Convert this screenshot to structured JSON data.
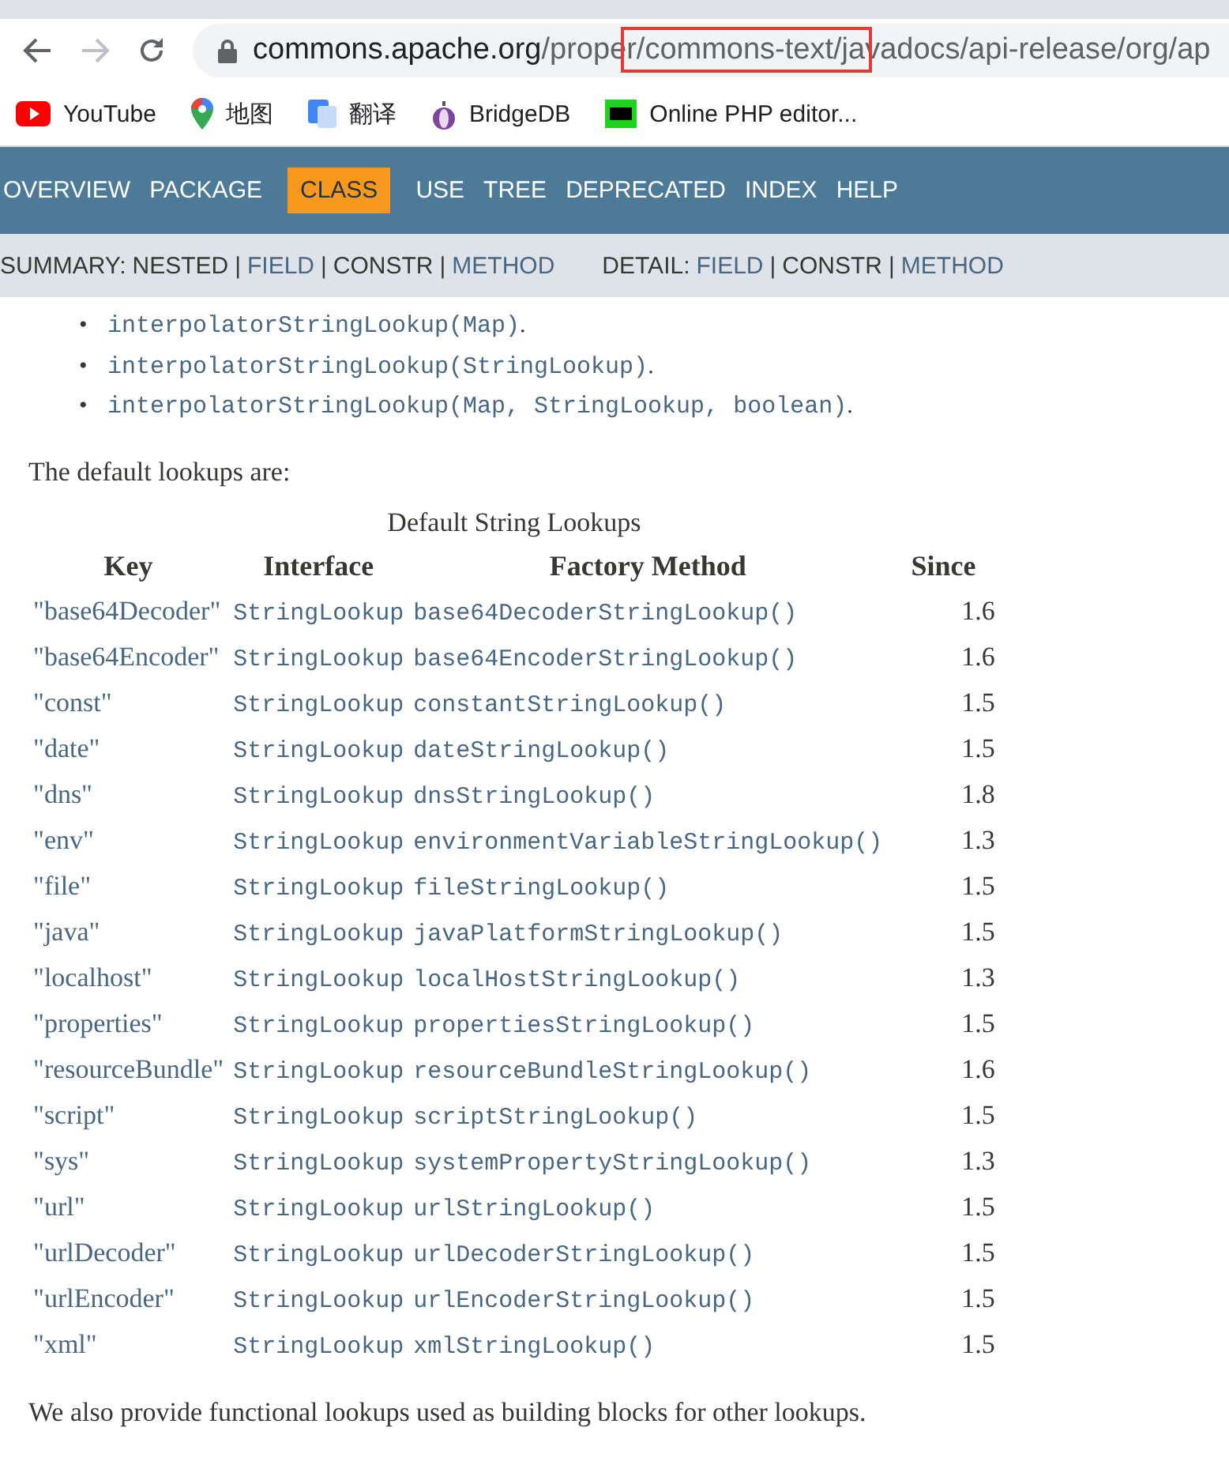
{
  "browser": {
    "url": {
      "host": "commons.apache.org",
      "path_before": "/prope",
      "highlighted": "r/commons-text/ja",
      "path_after": "vadocs/api-release/org/ap"
    },
    "bookmarks": [
      {
        "kind": "youtube",
        "label": "YouTube"
      },
      {
        "kind": "maps",
        "label": "地图"
      },
      {
        "kind": "translate",
        "label": "翻译"
      },
      {
        "kind": "onion",
        "label": "BridgeDB"
      },
      {
        "kind": "php",
        "label": "Online PHP editor..."
      }
    ]
  },
  "nav": [
    {
      "label": "OVERVIEW",
      "selected": false
    },
    {
      "label": "PACKAGE",
      "selected": false
    },
    {
      "label": "CLASS",
      "selected": true
    },
    {
      "label": "USE",
      "selected": false
    },
    {
      "label": "TREE",
      "selected": false
    },
    {
      "label": "DEPRECATED",
      "selected": false
    },
    {
      "label": "INDEX",
      "selected": false
    },
    {
      "label": "HELP",
      "selected": false
    }
  ],
  "subnav": [
    {
      "title": "SUMMARY:",
      "items": [
        {
          "label": "NESTED",
          "kind": "plain"
        },
        {
          "label": "FIELD",
          "kind": "link"
        },
        {
          "label": "CONSTR",
          "kind": "plain"
        },
        {
          "label": "METHOD",
          "kind": "link"
        }
      ]
    },
    {
      "title": "DETAIL:",
      "items": [
        {
          "label": "FIELD",
          "kind": "link"
        },
        {
          "label": "CONSTR",
          "kind": "plain"
        },
        {
          "label": "METHOD",
          "kind": "link"
        }
      ]
    }
  ],
  "separator": "|",
  "list": [
    {
      "bullet": "•",
      "link": "interpolatorStringLookup(Map)",
      "after": "."
    },
    {
      "bullet": "•",
      "link": "interpolatorStringLookup(StringLookup)",
      "after": "."
    },
    {
      "bullet": "•",
      "link": "interpolatorStringLookup(Map, StringLookup, boolean)",
      "after": "."
    }
  ],
  "intro": "The default lookups are:",
  "table": {
    "caption": "Default String Lookups",
    "columns": [
      "Key",
      "Interface",
      "Factory Method",
      "Since"
    ],
    "rows": [
      [
        "\"base64Decoder\"",
        "StringLookup",
        "base64DecoderStringLookup()",
        "1.6"
      ],
      [
        "\"base64Encoder\"",
        "StringLookup",
        "base64EncoderStringLookup()",
        "1.6"
      ],
      [
        "\"const\"",
        "StringLookup",
        "constantStringLookup()",
        "1.5"
      ],
      [
        "\"date\"",
        "StringLookup",
        "dateStringLookup()",
        "1.5"
      ],
      [
        "\"dns\"",
        "StringLookup",
        "dnsStringLookup()",
        "1.8"
      ],
      [
        "\"env\"",
        "StringLookup",
        "environmentVariableStringLookup()",
        "1.3"
      ],
      [
        "\"file\"",
        "StringLookup",
        "fileStringLookup()",
        "1.5"
      ],
      [
        "\"java\"",
        "StringLookup",
        "javaPlatformStringLookup()",
        "1.5"
      ],
      [
        "\"localhost\"",
        "StringLookup",
        "localHostStringLookup()",
        "1.3"
      ],
      [
        "\"properties\"",
        "StringLookup",
        "propertiesStringLookup()",
        "1.5"
      ],
      [
        "\"resourceBundle\"",
        "StringLookup",
        "resourceBundleStringLookup()",
        "1.6"
      ],
      [
        "\"script\"",
        "StringLookup",
        "scriptStringLookup()",
        "1.5"
      ],
      [
        "\"sys\"",
        "StringLookup",
        "systemPropertyStringLookup()",
        "1.3"
      ],
      [
        "\"url\"",
        "StringLookup",
        "urlStringLookup()",
        "1.5"
      ],
      [
        "\"urlDecoder\"",
        "StringLookup",
        "urlDecoderStringLookup()",
        "1.5"
      ],
      [
        "\"urlEncoder\"",
        "StringLookup",
        "urlEncoderStringLookup()",
        "1.5"
      ],
      [
        "\"xml\"",
        "StringLookup",
        "xmlStringLookup()",
        "1.5"
      ]
    ]
  },
  "outro": "We also provide functional lookups used as building blocks for other lookups."
}
